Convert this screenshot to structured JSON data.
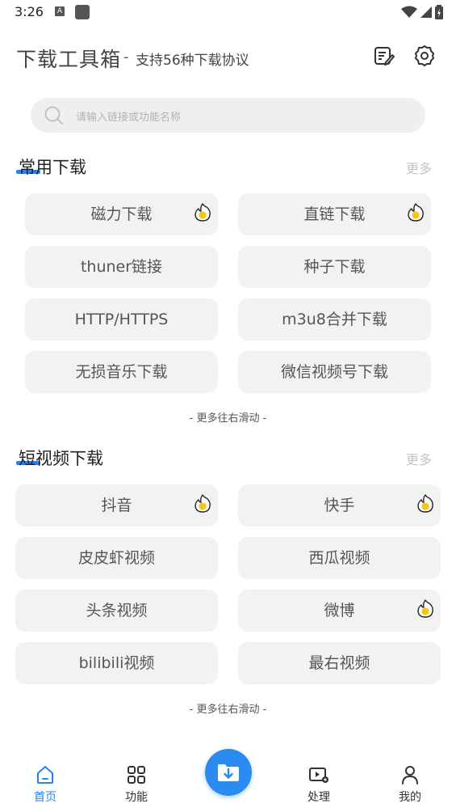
{
  "status_bar": {
    "time": "3:26",
    "notif_a": "A"
  },
  "header": {
    "title": "下载工具箱",
    "separator": "-",
    "subtitle": "支持56种下载协议"
  },
  "search": {
    "placeholder": "请输入链接或功能名称"
  },
  "common": {
    "title": "常用下载",
    "more": "更多",
    "items": [
      {
        "label": "磁力下载",
        "hot": true
      },
      {
        "label": "直链下载",
        "hot": true
      },
      {
        "label": "thuner链接",
        "hot": false
      },
      {
        "label": "种子下载",
        "hot": false
      },
      {
        "label": "HTTP/HTTPS",
        "hot": false
      },
      {
        "label": "m3u8合并下载",
        "hot": false
      },
      {
        "label": "无损音乐下载",
        "hot": false
      },
      {
        "label": "微信视频号下载",
        "hot": false
      }
    ],
    "hint": "- 更多往右滑动 -"
  },
  "short_video": {
    "title": "短视频下载",
    "more": "更多",
    "items": [
      {
        "label": "抖音",
        "hot": true
      },
      {
        "label": "快手",
        "hot": true
      },
      {
        "label": "皮皮虾视频",
        "hot": false
      },
      {
        "label": "西瓜视频",
        "hot": false
      },
      {
        "label": "头条视频",
        "hot": false
      },
      {
        "label": "微博",
        "hot": true
      },
      {
        "label": "bilibili视频",
        "hot": false
      },
      {
        "label": "最右视频",
        "hot": false
      }
    ],
    "hint": "- 更多往右滑动 -"
  },
  "tabbar": {
    "home": "首页",
    "features": "功能",
    "process": "处理",
    "mine": "我的",
    "accent_color": "#2b83ea"
  },
  "icons": {
    "hot": "fire-badge-icon",
    "fab": "download-folder-icon"
  }
}
